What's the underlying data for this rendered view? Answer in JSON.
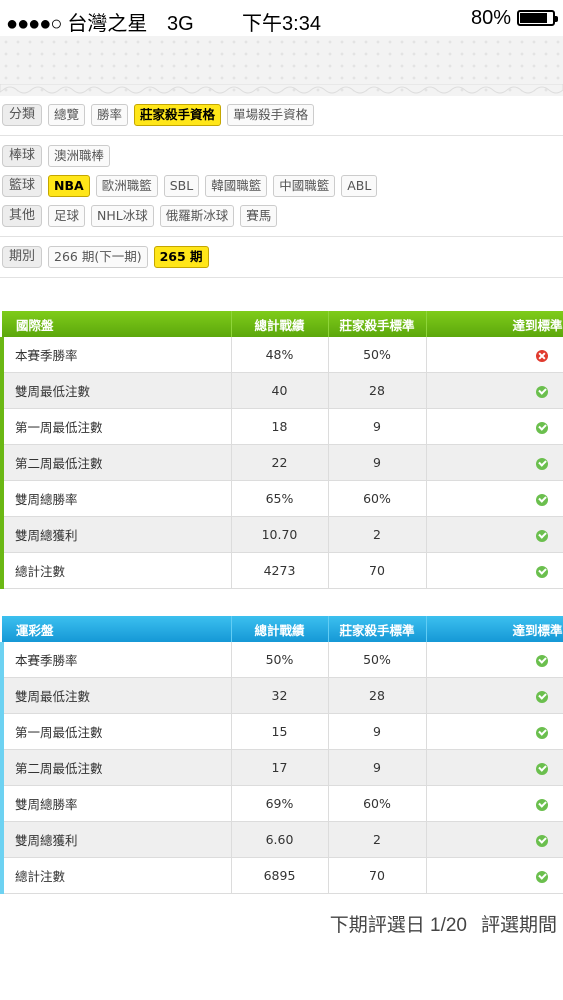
{
  "status_bar": {
    "signal": "●●●●○",
    "carrier": "台灣之星",
    "network": "3G",
    "time": "下午3:34",
    "battery": "80%"
  },
  "filters": {
    "category": {
      "label": "分類",
      "options": [
        "總覽",
        "勝率",
        "莊家殺手資格",
        "單場殺手資格"
      ],
      "active": "莊家殺手資格"
    },
    "baseball": {
      "label": "棒球",
      "options": [
        "澳洲職棒"
      ]
    },
    "basketball": {
      "label": "籃球",
      "options": [
        "NBA",
        "歐洲職籃",
        "SBL",
        "韓國職籃",
        "中國職籃",
        "ABL"
      ],
      "active": "NBA"
    },
    "other": {
      "label": "其他",
      "options": [
        "足球",
        "NHL冰球",
        "俄羅斯冰球",
        "賽馬"
      ]
    },
    "period": {
      "label": "期別",
      "options": [
        "266 期(下一期)",
        "265 期"
      ],
      "active": "265 期"
    }
  },
  "table_international": {
    "headers": [
      "國際盤",
      "總計戰績",
      "莊家殺手標準",
      "達到標準"
    ],
    "rows": [
      {
        "name": "本賽季勝率",
        "record": "48%",
        "standard": "50%",
        "met": false
      },
      {
        "name": "雙周最低注數",
        "record": "40",
        "standard": "28",
        "met": true
      },
      {
        "name": "第一周最低注數",
        "record": "18",
        "standard": "9",
        "met": true
      },
      {
        "name": "第二周最低注數",
        "record": "22",
        "standard": "9",
        "met": true
      },
      {
        "name": "雙周總勝率",
        "record": "65%",
        "standard": "60%",
        "met": true
      },
      {
        "name": "雙周總獲利",
        "record": "10.70",
        "standard": "2",
        "met": true
      },
      {
        "name": "總計注數",
        "record": "4273",
        "standard": "70",
        "met": true
      }
    ]
  },
  "table_lottery": {
    "headers": [
      "運彩盤",
      "總計戰績",
      "莊家殺手標準",
      "達到標準"
    ],
    "rows": [
      {
        "name": "本賽季勝率",
        "record": "50%",
        "standard": "50%",
        "met": true
      },
      {
        "name": "雙周最低注數",
        "record": "32",
        "standard": "28",
        "met": true
      },
      {
        "name": "第一周最低注數",
        "record": "15",
        "standard": "9",
        "met": true
      },
      {
        "name": "第二周最低注數",
        "record": "17",
        "standard": "9",
        "met": true
      },
      {
        "name": "雙周總勝率",
        "record": "69%",
        "standard": "60%",
        "met": true
      },
      {
        "name": "雙周總獲利",
        "record": "6.60",
        "standard": "2",
        "met": true
      },
      {
        "name": "總計注數",
        "record": "6895",
        "standard": "70",
        "met": true
      }
    ]
  },
  "footer": {
    "next_review": "下期評選日 1/20",
    "review_period": "評選期間"
  }
}
